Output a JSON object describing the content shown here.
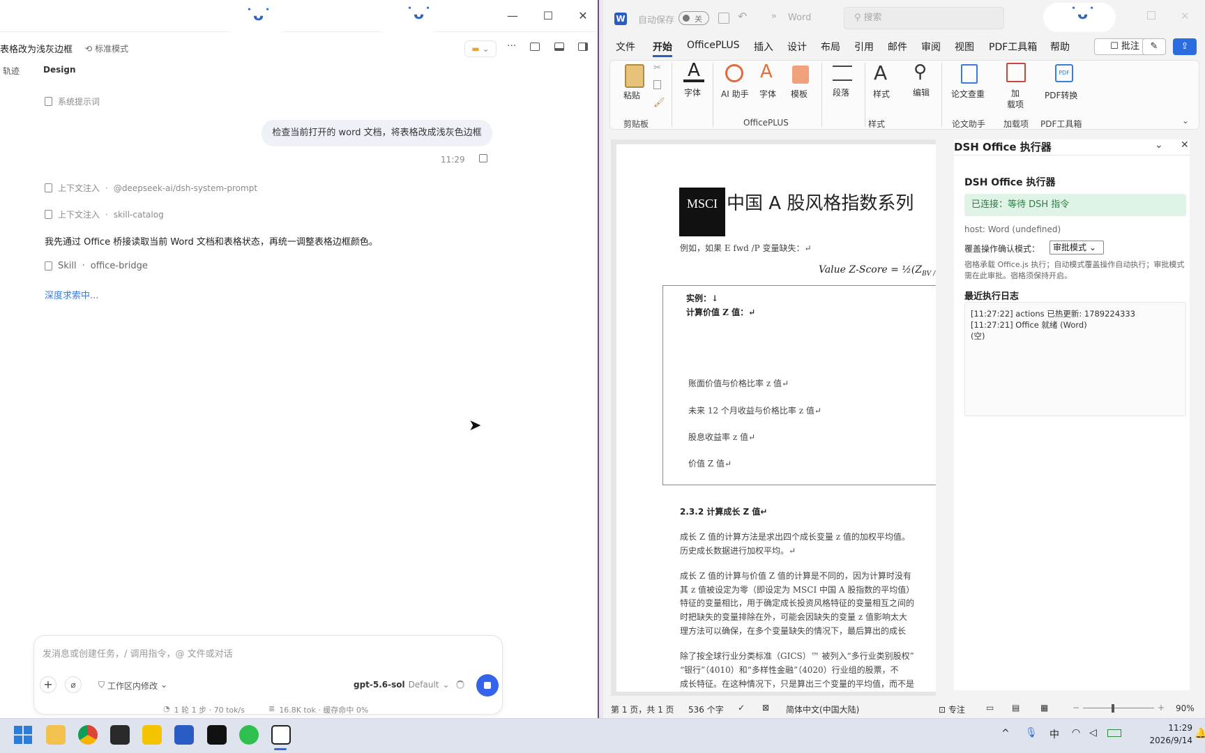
{
  "chat": {
    "title": "表格改为浅灰边框",
    "mode": "标准模式",
    "tabs": [
      "轨迹",
      "Design"
    ],
    "system_prompt": "系统提示词",
    "user_message": "检查当前打开的 word 文档，将表格改成浅灰色边框",
    "time": "11:29",
    "context1_label": "上下文注入",
    "context1_value": "@deepseek-ai/dsh-system-prompt",
    "context2_label": "上下文注入",
    "context2_value": "skill-catalog",
    "assistant_text": "我先通过 Office 桥接读取当前 Word 文档和表格状态，再统一调整表格边框颜色。",
    "skill_label": "Skill",
    "skill_value": "office-bridge",
    "thinking": "深度求索中...",
    "input_placeholder": "发消息或创建任务，/ 调用指令，@ 文件或对话",
    "workspace": "工作区内修改",
    "model": "gpt-5.6-sol",
    "model_variant": "Default",
    "stats_steps": "1 轮 1 步 · 70 tok/s",
    "stats_tokens": "16.8K tok · 缓存命中 0%"
  },
  "word": {
    "autosave": "自动保存",
    "autosave_state": "关",
    "app_name": "Word",
    "search_placeholder": "搜索",
    "tabs": [
      "文件",
      "开始",
      "OfficePLUS",
      "插入",
      "设计",
      "布局",
      "引用",
      "邮件",
      "审阅",
      "视图",
      "PDF工具箱",
      "帮助"
    ],
    "comment_btn": "批注",
    "ribbon": {
      "paste": "粘贴",
      "font_big": "字体",
      "ai": "AI 助手",
      "font2": "字体",
      "template": "模板",
      "paragraph": "段落",
      "styles": "样式",
      "edit": "编辑",
      "thesis": "论文查重",
      "addin": "加\n载项",
      "pdf": "PDF转换",
      "group_clipboard": "剪贴板",
      "group_officeplus": "OfficePLUS",
      "group_styles": "样式",
      "group_thesis": "论文助手",
      "group_addin": "加载项",
      "group_pdf": "PDF工具箱"
    },
    "doc": {
      "msci": "MSCI",
      "heading": "中国 A 股风格指数系列",
      "l1": "例如，如果 E fwd /P 变量缺失：↵",
      "formula": "Value Z-Score = ½(Z",
      "formula_sub": "BV / P",
      "ex1": "实例：↓",
      "ex2": "计算价值 Z 值：↵",
      "t1": "账面价值与价格比率 z 值↵",
      "t2": "未来 12 个月收益与价格比率 z 值↵",
      "t3": "股息收益率 z 值↵",
      "t4": "价值 Z 值↵",
      "h232": "2.3.2  计算成长 Z 值↵",
      "p1a": "成长 Z 值的计算方法是求出四个成长变量 z 值的加权平均值。",
      "p1b": "历史成长数据进行加权平均。↵",
      "p2a": "成长 Z 值的计算与价值 Z 值的计算是不同的，因为计算时没有",
      "p2b": "其 z 值被设定为零（即设定为 MSCI 中国 A 股指数的平均值）",
      "p2c": "特征的变量相比，用于确定成长投资风格特征的变量相互之间的",
      "p2d": "时把缺失的变量排除在外，可能会因缺失的变量 z 值影响太大",
      "p2e": "理方法可以确保，在多个变量缺失的情况下，最后算出的成长",
      "p3a": "除了按全球行业分类标准（GICS）™ 被列入“多行业类别股权”",
      "p3b": "“银行”（4010）和“多样性金融”（4020）行业组的股票，不",
      "p3c": "成长特征。在这种情况下，只是算出三个变量的平均值，而不是"
    },
    "pane": {
      "title": "DSH Office 执行器",
      "inner_title": "DSH Office 执行器",
      "status": "已连接：等待 DSH 指令",
      "host": "host: Word (undefined)",
      "override_label": "覆盖操作确认模式：",
      "override_value": "审批模式",
      "desc": "宿格承载 Office.js 执行；自动模式覆盖操作自动执行；审批模式需在此审批。宿格须保持开启。",
      "log_title": "最近执行日志",
      "log1": "[11:27:22] actions 已热更新: 1789224333",
      "log2": "[11:27:21] Office 就绪 (Word)",
      "log3": "(空)"
    },
    "status": {
      "page": "第 1 页，共 1 页",
      "words": "536 个字",
      "lang": "简体中文(中国大陆)",
      "focus": "专注",
      "zoom": "90%"
    }
  },
  "taskbar": {
    "time": "11:29",
    "date": "2026/9/14",
    "ime": "中"
  }
}
